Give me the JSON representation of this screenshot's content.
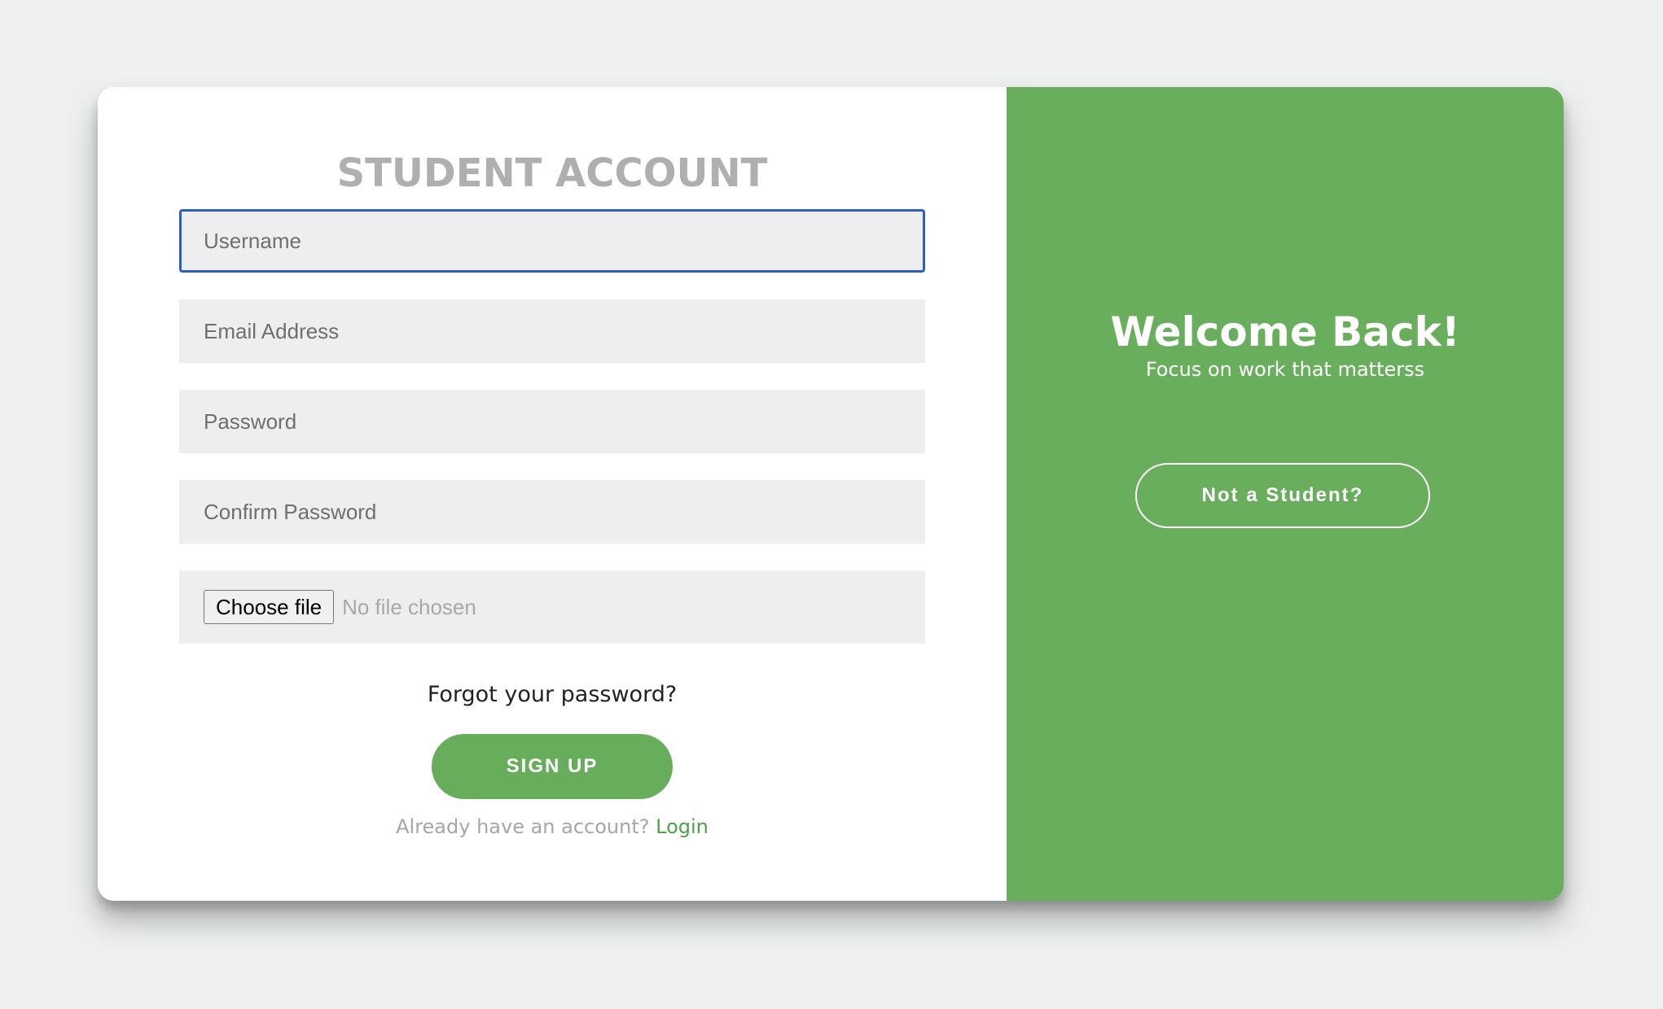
{
  "form": {
    "title": "STUDENT ACCOUNT",
    "username_placeholder": "Username",
    "email_placeholder": "Email Address",
    "password_placeholder": "Password",
    "confirm_password_placeholder": "Confirm Password",
    "file_button_label": "Choose file",
    "file_status": "No file chosen",
    "forgot_password": "Forgot your password?",
    "signup_label": "SIGN UP",
    "have_account_text": "Already have an account?",
    "login_link": "Login"
  },
  "side": {
    "welcome_title": "Welcome Back!",
    "tagline": "Focus on work that matterss",
    "switch_button_label": "Not a Student?"
  },
  "colors": {
    "accent_green": "#68ad5b",
    "focus_border": "#2d5fc2",
    "title_gray": "#afafaf",
    "field_bg": "#eeeeee",
    "page_bg": "#edf0ef"
  }
}
